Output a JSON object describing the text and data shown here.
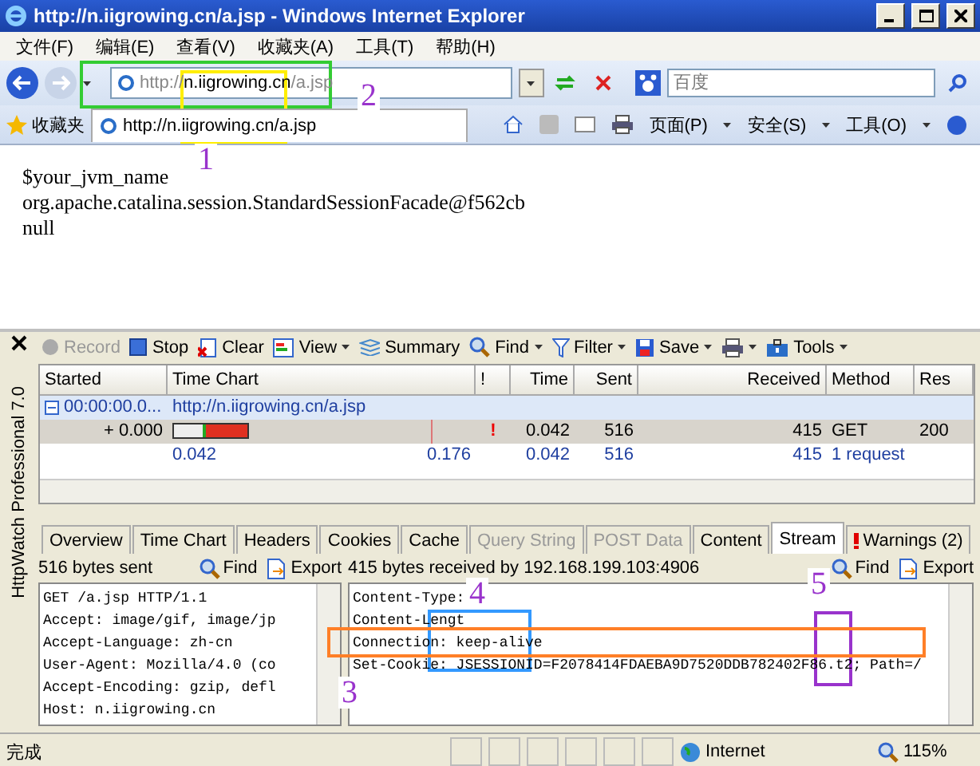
{
  "window": {
    "title": "http://n.iigrowing.cn/a.jsp - Windows Internet Explorer"
  },
  "menu": [
    "文件(F)",
    "编辑(E)",
    "查看(V)",
    "收藏夹(A)",
    "工具(T)",
    "帮助(H)"
  ],
  "address_bar": {
    "prefix": "http://",
    "domain": "n.iigrowing.cn",
    "path": "/a.jsp"
  },
  "search": {
    "placeholder": "百度"
  },
  "favorites": {
    "label": "收藏夹",
    "tabs": [
      {
        "label": "http://n.iigrowing.cn/a.jsp",
        "selected": true
      }
    ]
  },
  "command_bar": [
    "页面(P)",
    "安全(S)",
    "工具(O)"
  ],
  "page_content": {
    "lines": [
      "$your_jvm_name",
      "org.apache.catalina.session.StandardSessionFacade@f562cb",
      "null"
    ]
  },
  "httpwatch": {
    "side_title": "HttpWatch Professional 7.0",
    "toolbar": [
      {
        "kind": "record",
        "label": "Record",
        "disabled": true,
        "dropdown": false
      },
      {
        "kind": "stop",
        "label": "Stop",
        "disabled": false,
        "dropdown": false
      },
      {
        "kind": "clear",
        "label": "Clear",
        "disabled": false,
        "dropdown": false
      },
      {
        "kind": "view",
        "label": "View",
        "disabled": false,
        "dropdown": true
      },
      {
        "kind": "summary",
        "label": "Summary",
        "disabled": false,
        "dropdown": false
      },
      {
        "kind": "find",
        "label": "Find",
        "disabled": false,
        "dropdown": true
      },
      {
        "kind": "filter",
        "label": "Filter",
        "disabled": false,
        "dropdown": true
      },
      {
        "kind": "save",
        "label": "Save",
        "disabled": false,
        "dropdown": true
      },
      {
        "kind": "print",
        "disabled": false,
        "dropdown": true
      },
      {
        "kind": "tools",
        "label": "Tools",
        "disabled": false,
        "dropdown": true
      }
    ],
    "columns": [
      "Started",
      "Time Chart",
      "!",
      "Time",
      "Sent",
      "Received",
      "Method",
      "Res"
    ],
    "group": {
      "started": "00:00:00.0...",
      "url": "http://n.iigrowing.cn/a.jsp",
      "expanded": true,
      "selected": true
    },
    "request": {
      "started": "+ 0.000",
      "warning": "!",
      "time": "0.042",
      "sent": "516",
      "received": "415",
      "method": "GET",
      "result": "200"
    },
    "summary": {
      "chart_start": "0.042",
      "chart_end": "0.176",
      "time": "0.042",
      "sent": "516",
      "received": "415",
      "count": "1 request"
    },
    "tabs": [
      {
        "label": "Overview",
        "selected": false,
        "disabled": false,
        "warning": false
      },
      {
        "label": "Time Chart",
        "selected": false,
        "disabled": false,
        "warning": false
      },
      {
        "label": "Headers",
        "selected": false,
        "disabled": false,
        "warning": false
      },
      {
        "label": "Cookies",
        "selected": false,
        "disabled": false,
        "warning": false
      },
      {
        "label": "Cache",
        "selected": false,
        "disabled": false,
        "warning": false
      },
      {
        "label": "Query String",
        "selected": false,
        "disabled": true,
        "warning": false
      },
      {
        "label": "POST Data",
        "selected": false,
        "disabled": true,
        "warning": false
      },
      {
        "label": "Content",
        "selected": false,
        "disabled": false,
        "warning": false
      },
      {
        "label": "Stream",
        "selected": true,
        "disabled": false,
        "warning": false
      },
      {
        "label": "Warnings (2)",
        "selected": false,
        "disabled": false,
        "warning": true
      }
    ],
    "sent_pane": {
      "caption": "516 bytes sent",
      "find": "Find",
      "export": "Export",
      "lines": [
        "GET /a.jsp HTTP/1.1",
        "Accept: image/gif, image/jp",
        "Accept-Language: zh-cn",
        "User-Agent: Mozilla/4.0 (co",
        "Accept-Encoding: gzip, defl",
        "Host: n.iigrowing.cn"
      ]
    },
    "received_pane": {
      "caption": "415 bytes received by 192.168.199.103:4906",
      "find": "Find",
      "export": "Export",
      "lines": [
        "Content-Type:",
        "Content-Lengt",
        "Connection: keep-alive",
        "Set-Cookie: JSESSIONID=F2078414FDAEBA9D7520DDB782402F86.t2; Path=/"
      ]
    }
  },
  "status_bar": {
    "text": "完成",
    "zone": "Internet",
    "zoom": "115%"
  },
  "annotations": [
    {
      "kind": "rect",
      "color": "#33cc33"
    },
    {
      "kind": "rect",
      "color": "#ffee00"
    },
    {
      "kind": "rect",
      "color": "#3399ff"
    },
    {
      "kind": "rect",
      "color": "#9933cc"
    },
    {
      "kind": "rect",
      "color": "#ff7f27"
    },
    {
      "kind": "label",
      "text": "1",
      "color": "#9933cc"
    },
    {
      "kind": "label",
      "text": "2",
      "color": "#9933cc"
    },
    {
      "kind": "label",
      "text": "3",
      "color": "#9933cc"
    },
    {
      "kind": "label",
      "text": "4",
      "color": "#9933cc"
    },
    {
      "kind": "label",
      "text": "5",
      "color": "#9933cc"
    }
  ]
}
